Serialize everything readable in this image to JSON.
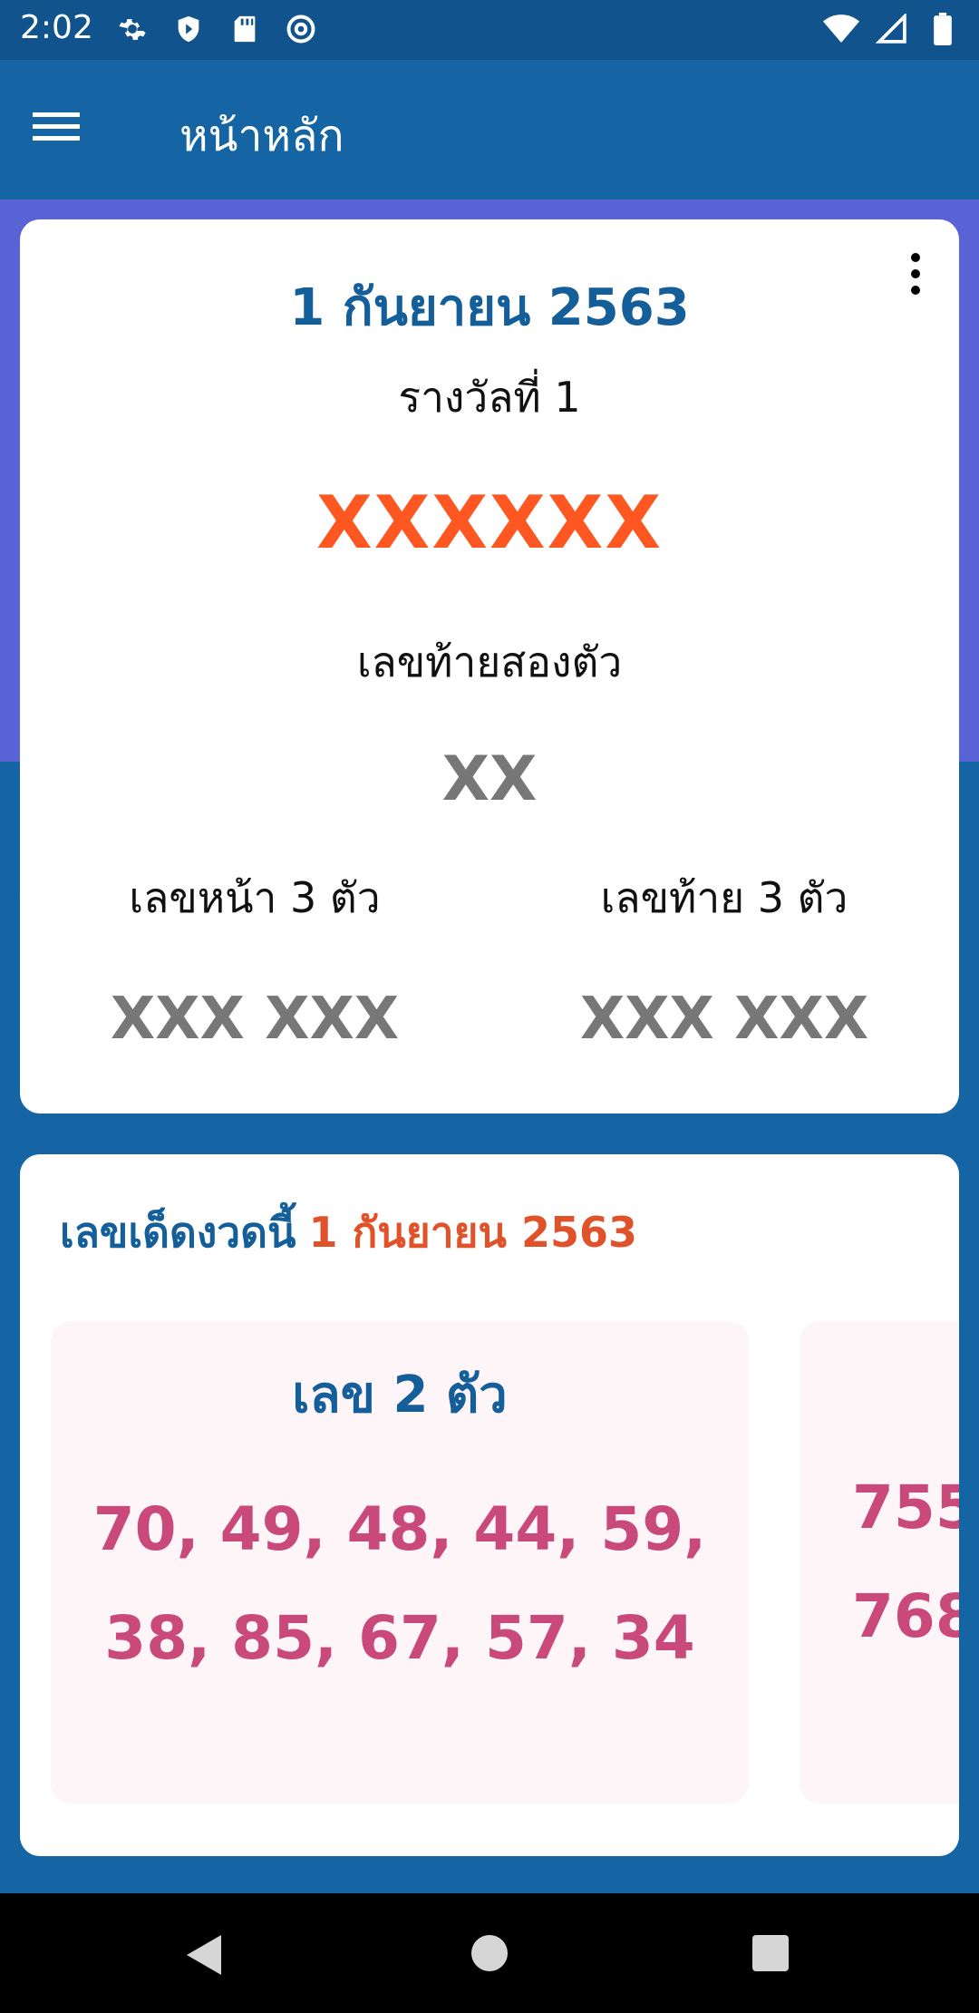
{
  "status_bar": {
    "time": "2:02",
    "left_icons": [
      "gear-icon",
      "shield-icon",
      "sd-card-icon",
      "at-sign-icon"
    ],
    "right_icons": [
      "wifi-icon",
      "signal-icon",
      "battery-icon"
    ]
  },
  "app_bar": {
    "title": "หน้าหลัก",
    "menu_icon": "hamburger-icon"
  },
  "result_card": {
    "draw_date": "1 กันยายน 2563",
    "first_prize_label": "รางวัลที่ 1",
    "first_prize_number": "XXXXXX",
    "last_two_label": "เลขท้ายสองตัว",
    "last_two_number": "XX",
    "front_three_label": "เลขหน้า 3 ตัว",
    "front_three_number": "XXX XXX",
    "back_three_label": "เลขท้าย 3 ตัว",
    "back_three_number": "XXX XXX"
  },
  "tips_card": {
    "heading": "เลขเด็ดงวดนี้",
    "heading_date": "1 กันยายน 2563",
    "panels": [
      {
        "title": "เลข 2 ตัว",
        "numbers_line1": "70, 49, 48, 44, 59,",
        "numbers_line2": "38, 85, 67, 57, 34"
      },
      {
        "numbers_line1": "755",
        "numbers_line2": "768"
      }
    ]
  },
  "colors": {
    "primary": "#1565a4",
    "status_bar": "#11548d",
    "accent_orange": "#ff5722",
    "number_pink": "#c94a7a",
    "gray_number": "#777777"
  }
}
